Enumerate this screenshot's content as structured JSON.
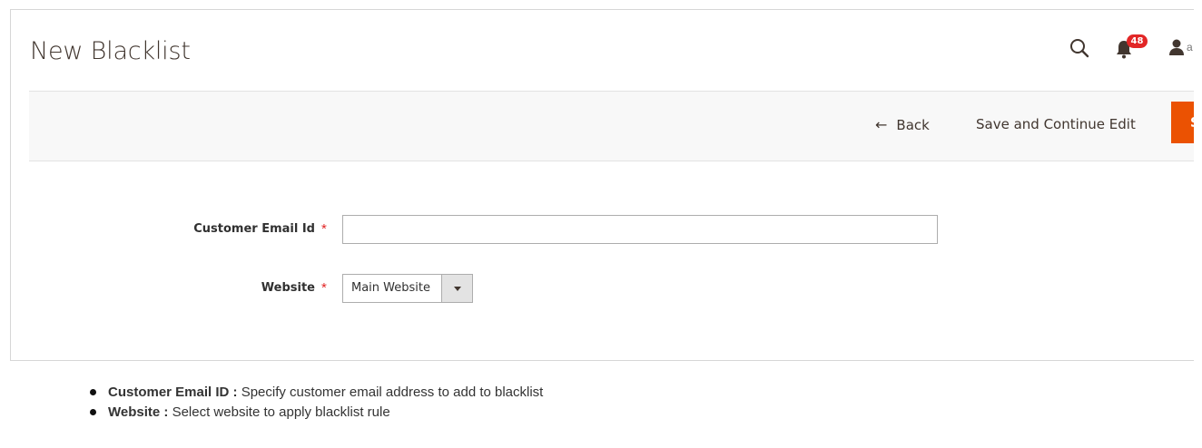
{
  "page": {
    "title": "New Blacklist"
  },
  "header": {
    "notification_count": "48",
    "user_initial": "a"
  },
  "toolbar": {
    "back_arrow": "←",
    "back_label": "Back",
    "save_continue_label": "Save and Continue Edit",
    "save_label": "S",
    "save_color": "#eb5202"
  },
  "form": {
    "fields": [
      {
        "label": "Customer Email Id",
        "required_mark": "*",
        "value": "",
        "placeholder": ""
      },
      {
        "label": "Website",
        "required_mark": "*",
        "selected": "Main Website"
      }
    ]
  },
  "notes": [
    {
      "term": "Customer Email ID :",
      "text": " Specify customer email address to add to blacklist"
    },
    {
      "term": "Website :",
      "text": " Select website to apply blacklist rule"
    }
  ],
  "icons": {
    "search": "search-icon",
    "notifications": "bell-icon",
    "user": "user-icon",
    "dropdown": "chevron-down-icon",
    "bullet": "bullet-icon"
  },
  "colors": {
    "accent": "#eb5202",
    "required": "#e22626",
    "badge": "#e22626"
  }
}
